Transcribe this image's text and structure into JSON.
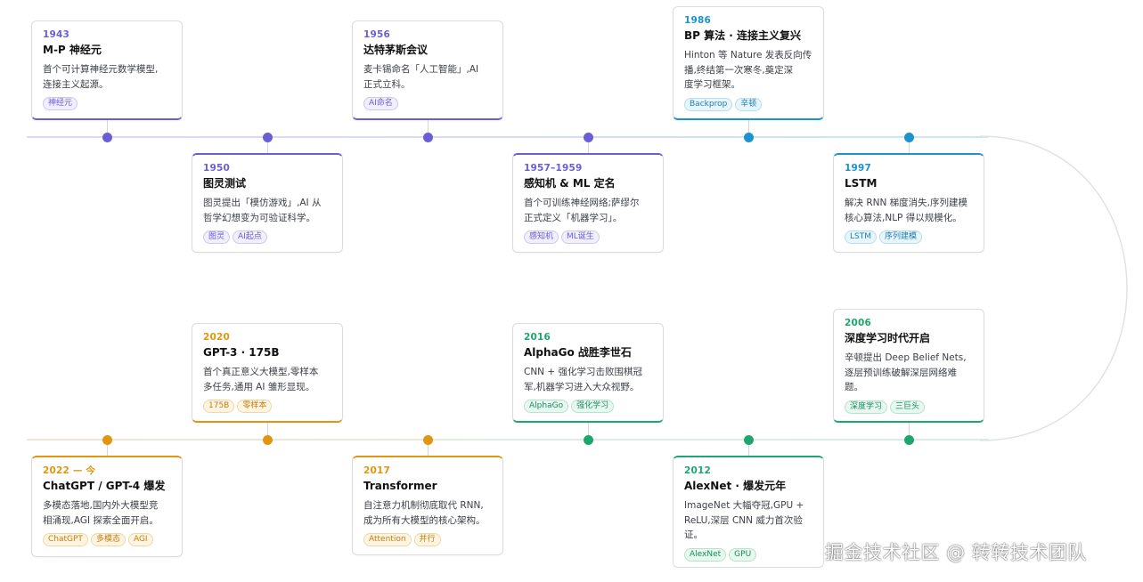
{
  "colors": {
    "purple": "#6a5ed6",
    "blue": "#1c93cf",
    "green": "#1fa56f",
    "orange": "#e2960f"
  },
  "events": [
    {
      "id": "1943",
      "year": "1943",
      "title": "M-P 神经元",
      "desc": [
        "首个可计算神经元数学模型,",
        "连接主义起源。"
      ],
      "tags": [
        "神经元"
      ],
      "theme": "purple"
    },
    {
      "id": "1950",
      "year": "1950",
      "title": "图灵测试",
      "desc": [
        "图灵提出「模仿游戏」,AI 从",
        "哲学幻想变为可验证科学。"
      ],
      "tags": [
        "图灵",
        "AI起点"
      ],
      "theme": "purple"
    },
    {
      "id": "1956",
      "year": "1956",
      "title": "达特茅斯会议",
      "desc": [
        "麦卡锡命名「人工智能」,AI",
        "正式立科。"
      ],
      "tags": [
        "AI命名"
      ],
      "theme": "purple"
    },
    {
      "id": "1957",
      "year": "1957–1959",
      "title": "感知机 & ML 定名",
      "desc": [
        "首个可训练神经网络;萨缪尔",
        "正式定义「机器学习」。"
      ],
      "tags": [
        "感知机",
        "ML诞生"
      ],
      "theme": "purple"
    },
    {
      "id": "1986",
      "year": "1986",
      "title": "BP 算法 · 连接主义复兴",
      "desc": [
        "Hinton 等 Nature 发表反向传",
        "播,终结第一次寒冬,奠定深",
        "度学习框架。"
      ],
      "tags": [
        "Backprop",
        "辛顿"
      ],
      "theme": "blue"
    },
    {
      "id": "1997",
      "year": "1997",
      "title": "LSTM",
      "desc": [
        "解决 RNN 梯度消失,序列建模",
        "核心算法,NLP 得以规模化。"
      ],
      "tags": [
        "LSTM",
        "序列建模"
      ],
      "theme": "blue"
    },
    {
      "id": "2006",
      "year": "2006",
      "title": "深度学习时代开启",
      "desc": [
        "辛顿提出 Deep Belief Nets,",
        "逐层预训练破解深层网络难",
        "题。"
      ],
      "tags": [
        "深度学习",
        "三巨头"
      ],
      "theme": "green"
    },
    {
      "id": "2012",
      "year": "2012",
      "title": "AlexNet · 爆发元年",
      "desc": [
        "ImageNet 大幅夺冠,GPU +",
        "ReLU,深层 CNN 威力首次验",
        "证。"
      ],
      "tags": [
        "AlexNet",
        "GPU"
      ],
      "theme": "green"
    },
    {
      "id": "2016",
      "year": "2016",
      "title": "AlphaGo 战胜李世石",
      "desc": [
        "CNN + 强化学习击败围棋冠",
        "军,机器学习进入大众视野。"
      ],
      "tags": [
        "AlphaGo",
        "强化学习"
      ],
      "theme": "green"
    },
    {
      "id": "2017",
      "year": "2017",
      "title": "Transformer",
      "desc": [
        "自注意力机制彻底取代 RNN,",
        "成为所有大模型的核心架构。"
      ],
      "tags": [
        "Attention",
        "并行"
      ],
      "theme": "orange"
    },
    {
      "id": "2020",
      "year": "2020",
      "title": "GPT-3 · 175B",
      "desc": [
        "首个真正意义大模型,零样本",
        "多任务,通用 AI 雏形显现。"
      ],
      "tags": [
        "175B",
        "零样本"
      ],
      "theme": "orange"
    },
    {
      "id": "2022",
      "year": "2022 — 今",
      "title": "ChatGPT / GPT-4 爆发",
      "desc": [
        "多模态落地,国内外大模型竞",
        "相涌现,AGI 探索全面开启。"
      ],
      "tags": [
        "ChatGPT",
        "多模态",
        "AGI"
      ],
      "theme": "orange"
    }
  ],
  "watermark": "掘金技术社区 @ 转转技术团队"
}
